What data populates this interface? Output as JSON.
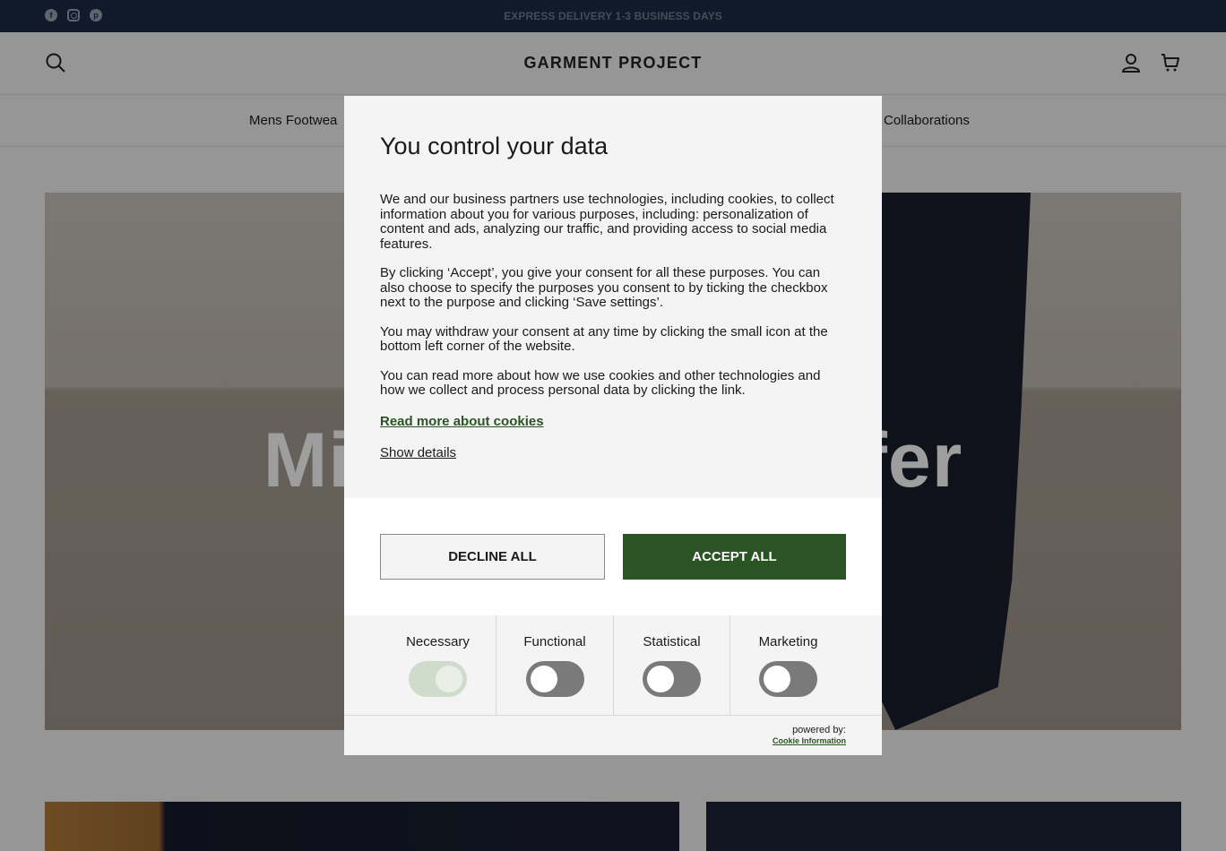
{
  "announcement": {
    "text": "EXPRESS DELIVERY 1-3 BUSINESS DAYS",
    "socials": [
      "facebook-icon",
      "instagram-icon",
      "pinterest-icon"
    ]
  },
  "header": {
    "logo": "GARMENT PROJECT",
    "icons": [
      "search-icon",
      "account-icon",
      "cart-icon"
    ]
  },
  "nav": {
    "items": [
      {
        "label": "Mens Footwea"
      },
      {
        "label": "Collaborations"
      }
    ]
  },
  "hero": {
    "headline_left": "Mi",
    "headline_right": "fer"
  },
  "cookie_modal": {
    "title": "You control your data",
    "paragraphs": [
      "We and our business partners use technologies, including cookies, to collect information about you for various purposes, including: personalization of content and ads, analyzing our traffic, and providing access to social media features.",
      "By clicking ‘Accept’, you give your consent for all these purposes. You can also choose to specify the purposes you consent to by ticking the checkbox next to the purpose and clicking ‘Save settings’.",
      "You may withdraw your consent at any time by clicking the small icon at the bottom left corner of the website.",
      "You can read more about how we use cookies and other technologies and how we collect and process personal data by clicking the link."
    ],
    "read_more_link": "Read more about cookies",
    "show_details_link": "Show details",
    "decline_button": "DECLINE ALL",
    "accept_button": "ACCEPT ALL",
    "categories": [
      {
        "label": "Necessary",
        "enabled": true
      },
      {
        "label": "Functional",
        "enabled": false
      },
      {
        "label": "Statistical",
        "enabled": false
      },
      {
        "label": "Marketing",
        "enabled": false
      }
    ],
    "powered_by": "powered by:",
    "powered_by_link": "Cookie Information"
  },
  "colors": {
    "announcement_bg": "#1b2a44",
    "accent_green": "#2b5424"
  }
}
